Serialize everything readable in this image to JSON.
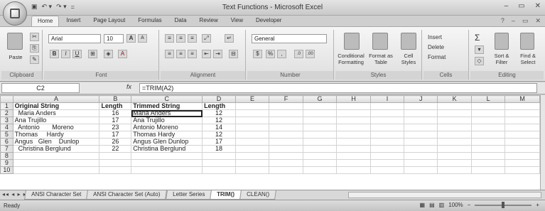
{
  "window": {
    "title": "Text Functions - Microsoft Excel",
    "minimize": "–",
    "restore": "▭",
    "close": "✕"
  },
  "qat": {
    "save": "▣",
    "undo": "↶ ▾",
    "redo": "↷ ▾",
    "more": "="
  },
  "ribbon_tabs": [
    "Home",
    "Insert",
    "Page Layout",
    "Formulas",
    "Data",
    "Review",
    "View",
    "Developer"
  ],
  "ribbon_right": {
    "help": "?",
    "min": "–",
    "restore": "▭",
    "close": "✕"
  },
  "ribbon": {
    "clipboard": {
      "label": "Clipboard",
      "paste": "Paste"
    },
    "font": {
      "label": "Font",
      "name": "Arial",
      "size": "10",
      "grow": "A",
      "shrink": "A",
      "bold": "B",
      "italic": "I",
      "underline": "U"
    },
    "alignment": {
      "label": "Alignment"
    },
    "number": {
      "label": "Number",
      "format": "General",
      "currency": "$",
      "percent": "%",
      "comma": ",",
      "inc_dec": ".0",
      "dec_dec": ".00"
    },
    "styles": {
      "label": "Styles",
      "conditional": "Conditional Formatting",
      "format_table": "Format as Table",
      "cell_styles": "Cell Styles"
    },
    "cells": {
      "label": "Cells",
      "insert": "Insert",
      "delete": "Delete",
      "format": "Format"
    },
    "editing": {
      "label": "Editing",
      "sum": "Σ",
      "sort": "Sort & Filter",
      "find": "Find & Select"
    }
  },
  "formula_bar": {
    "cell_ref": "C2",
    "fx": "fx",
    "formula": "=TRIM(A2)"
  },
  "columns": [
    "A",
    "B",
    "C",
    "D",
    "E",
    "F",
    "G",
    "H",
    "I",
    "J",
    "K",
    "L",
    "M"
  ],
  "rows": [
    {
      "n": "1",
      "a": "Original String",
      "b": "Length",
      "c": "Trimmed String",
      "d": "Length",
      "header": true
    },
    {
      "n": "2",
      "a": "  Maria Anders",
      "b": "16",
      "c": "Maria Anders",
      "d": "12"
    },
    {
      "n": "3",
      "a": "Ana Trujillo",
      "b": "17",
      "c": "Ana Trujillo",
      "d": "12"
    },
    {
      "n": "4",
      "a": "  Antonio       Moreno",
      "b": "23",
      "c": "Antonio Moreno",
      "d": "14"
    },
    {
      "n": "5",
      "a": "Thomas     Hardy",
      "b": "17",
      "c": "Thomas Hardy",
      "d": "12"
    },
    {
      "n": "6",
      "a": "Angus   Glen    Dunlop",
      "b": "26",
      "c": "Angus Glen Dunlop",
      "d": "17"
    },
    {
      "n": "7",
      "a": "  Christina Berglund",
      "b": "22",
      "c": "Christina Berglund",
      "d": "18"
    },
    {
      "n": "8",
      "a": "",
      "b": "",
      "c": "",
      "d": ""
    },
    {
      "n": "9",
      "a": "",
      "b": "",
      "c": "",
      "d": ""
    },
    {
      "n": "10",
      "a": "",
      "b": "",
      "c": "",
      "d": ""
    }
  ],
  "sheet_nav": "◂◂ ◂ ▸ ▸▸",
  "sheets": [
    "ANSI Character Set",
    "ANSI Character Set (Auto)",
    "Letter Series",
    "TRIM()",
    "CLEAN()"
  ],
  "active_sheet": "TRIM()",
  "status": {
    "text": "Ready",
    "zoom": "100%",
    "zoom_out": "−",
    "zoom_in": "+"
  }
}
